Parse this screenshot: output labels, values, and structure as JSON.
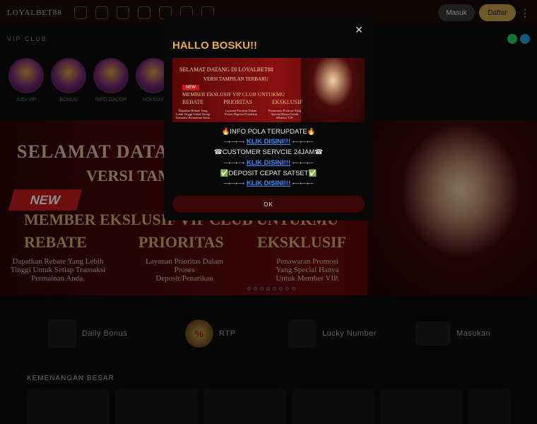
{
  "header": {
    "logo_text": "LOYALBET88",
    "login_label": "Masuk",
    "register_label": "Daftar",
    "menu_icon": "kebab-icon"
  },
  "subbar": {
    "label": "VIP CLUB"
  },
  "categories": [
    {
      "label": "JUDI VIP"
    },
    {
      "label": "BONUS"
    },
    {
      "label": "INFO GACOR"
    },
    {
      "label": "HOLIDAY"
    }
  ],
  "banner": {
    "title": "SELAMAT DATANG DI LOYALBET88",
    "subtitle": "VERSI TAMPILAN TERBARU",
    "new_badge": "NEW",
    "member_line": "MEMBER EKSLUSIF VIP CLUB UNTUKMU",
    "columns": [
      {
        "title": "REBATE",
        "desc": "Dapatkan Rebate Yang Lebih Tinggi Untuk Setiap Transaksi Permainan Anda."
      },
      {
        "title": "PRIORITAS",
        "desc": "Layanan Prioritas Dalam Proses Deposit/Penarikan"
      },
      {
        "title": "EKSKLUSIF",
        "desc": "Penawaran Promosi Yang Special Hanya Untuk Member VIP."
      }
    ]
  },
  "features": [
    {
      "label": "Daily Bonus",
      "icon": "gift-icon"
    },
    {
      "label": "RTP",
      "icon": "rtp-icon",
      "icon_text": "%"
    },
    {
      "label": "Lucky Number",
      "icon": "clover-icon"
    },
    {
      "label": "Masukan",
      "icon": "message-icon"
    }
  ],
  "big_wins": {
    "title": "KEMENANGAN BESAR"
  },
  "modal": {
    "title": "HALLO BOSKU!!",
    "banner_title": "SELAMAT DATANG DI LOYALBET88",
    "banner_sub": "VERSI TAMPILAN TERBARU",
    "banner_new": "NEW",
    "banner_member": "MEMBER EKSLUSIF VIP CLUB UNTUKMU",
    "banner_cols": [
      "REBATE",
      "PRIORITAS",
      "EKSKLUSIF"
    ],
    "banner_descs": [
      "Dapatkan Rebate Yang Lebih Tinggi Untuk Setiap Transaksi Permainan Anda.",
      "Layanan Prioritas Dalam Proses Deposit/Penarikan",
      "Penawaran Promosi Yang Special Hanya Untuk Member VIP."
    ],
    "info_line": "🔥INFO POLA TERUPDATE🔥",
    "link1": "KLIK DISINI!!!",
    "cs_line": "☎CUSTOMER SERVCIE 24JAM☎",
    "link2": "KLIK DISINI!!!",
    "deposit_line": "✅DEPOSIT CEPAT SATSET✅",
    "link3": "KLIK DISINI!!!",
    "arrow_left": "⟶⟶⟶",
    "arrow_right": "⟵⟵⟵",
    "ok_label": "OK"
  },
  "colors": {
    "accent_gold": "#e6b030",
    "link_blue": "#3a8cff",
    "register_gold": "#c8a24a"
  }
}
